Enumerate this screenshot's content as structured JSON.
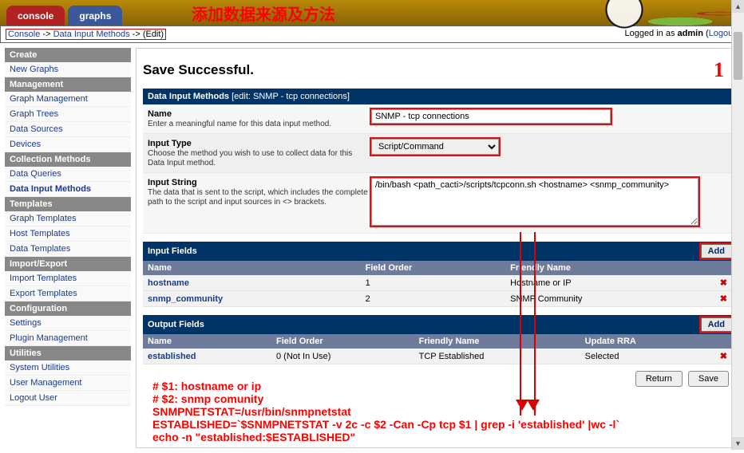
{
  "annotations": {
    "chinese_title": "添加数据来源及方法",
    "big_number": "1",
    "overlay_lines": [
      "# $1: hostname or ip",
      "# $2: snmp comunity",
      "SNMPNETSTAT=/usr/bin/snmpnetstat",
      "ESTABLISHED=`$SNMPNETSTAT -v 2c -c $2 -Can -Cp tcp $1 | grep -i 'established' |wc -l`",
      "echo -n \"established:$ESTABLISHED\""
    ]
  },
  "tabs": {
    "console": "console",
    "graphs": "graphs"
  },
  "breadcrumb": {
    "console": "Console",
    "dim": "Data Input Methods",
    "edit": "(Edit)",
    "sep": " -> ",
    "logged_in": "Logged in as",
    "user": "admin",
    "logout": "Logout"
  },
  "sidebar": {
    "sections": [
      {
        "title": "Create",
        "links": [
          {
            "label": "New Graphs"
          }
        ]
      },
      {
        "title": "Management",
        "links": [
          {
            "label": "Graph Management"
          },
          {
            "label": "Graph Trees"
          },
          {
            "label": "Data Sources"
          },
          {
            "label": "Devices"
          }
        ]
      },
      {
        "title": "Collection Methods",
        "links": [
          {
            "label": "Data Queries"
          },
          {
            "label": "Data Input Methods",
            "bold": true
          }
        ]
      },
      {
        "title": "Templates",
        "links": [
          {
            "label": "Graph Templates"
          },
          {
            "label": "Host Templates"
          },
          {
            "label": "Data Templates"
          }
        ]
      },
      {
        "title": "Import/Export",
        "links": [
          {
            "label": "Import Templates"
          },
          {
            "label": "Export Templates"
          }
        ]
      },
      {
        "title": "Configuration",
        "links": [
          {
            "label": "Settings"
          },
          {
            "label": "Plugin Management"
          }
        ]
      },
      {
        "title": "Utilities",
        "links": [
          {
            "label": "System Utilities"
          },
          {
            "label": "User Management"
          },
          {
            "label": "Logout User"
          }
        ]
      }
    ]
  },
  "content": {
    "success": "Save Successful.",
    "section_title": "Data Input Methods",
    "section_sub": "[edit: SNMP - tcp connections]",
    "fields": {
      "name": {
        "label": "Name",
        "help": "Enter a meaningful name for this data input method.",
        "value": "SNMP - tcp connections"
      },
      "type": {
        "label": "Input Type",
        "help": "Choose the method you wish to use to collect data for this Data Input method.",
        "value": "Script/Command"
      },
      "string": {
        "label": "Input String",
        "help": "The data that is sent to the script, which includes the complete path to the script and input sources in <> brackets.",
        "value": "/bin/bash <path_cacti>/scripts/tcpconn.sh <hostname> <snmp_community>"
      }
    },
    "input_fields": {
      "title": "Input Fields",
      "add": "Add",
      "cols": [
        "Name",
        "Field Order",
        "Friendly Name"
      ],
      "rows": [
        {
          "name": "hostname",
          "order": "1",
          "friendly": "Hostname or IP"
        },
        {
          "name": "snmp_community",
          "order": "2",
          "friendly": "SNMP Community"
        }
      ]
    },
    "output_fields": {
      "title": "Output Fields",
      "add": "Add",
      "cols": [
        "Name",
        "Field Order",
        "Friendly Name",
        "Update RRA"
      ],
      "rows": [
        {
          "name": "established",
          "order": "0 (Not In Use)",
          "friendly": "TCP Established",
          "rra": "Selected"
        }
      ]
    },
    "buttons": {
      "return": "Return",
      "save": "Save"
    }
  }
}
